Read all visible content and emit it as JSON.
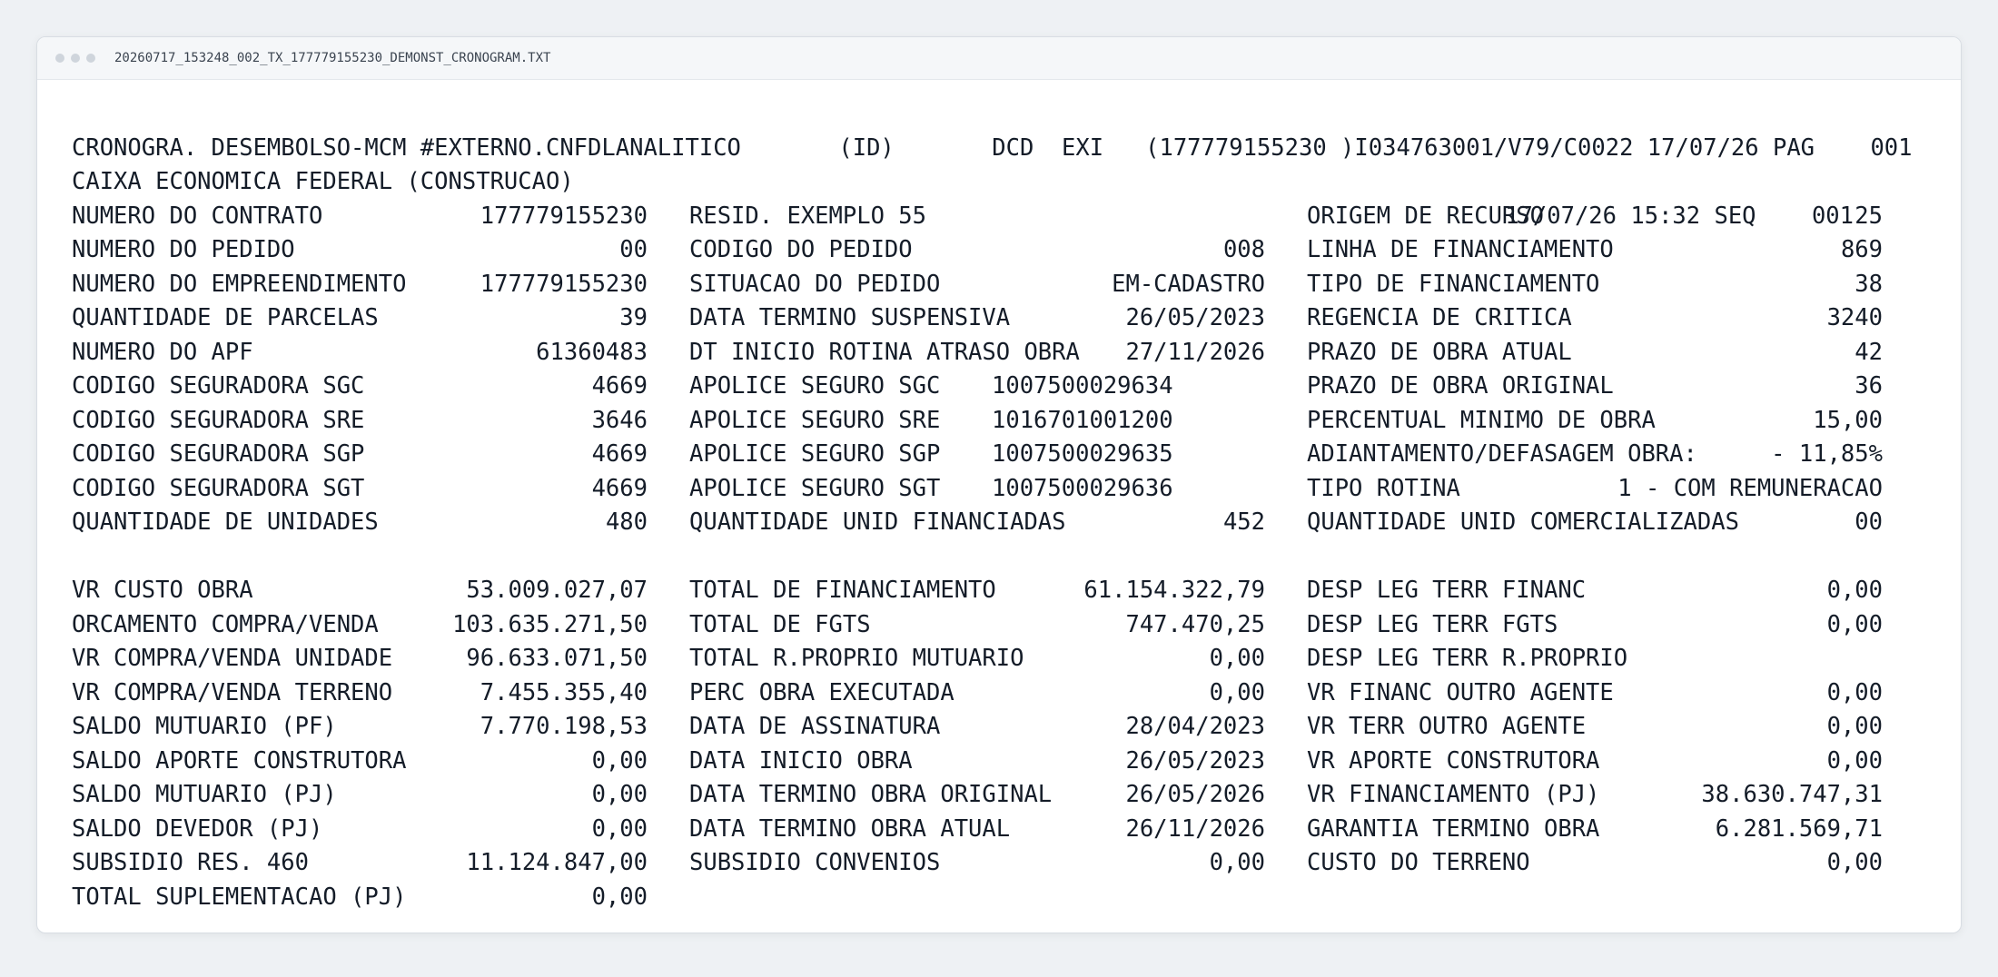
{
  "window": {
    "filename": "20260717_153248_002_TX_177779155230_DEMONST_CRONOGRAM.TXT"
  },
  "header": {
    "line1": "CRONOGRA. DESEMBOLSO-MCM #EXTERNO.CNFDLANALITICO       (ID)       DCD  EXI   (177779155230 )I034763001/V79/C0022 17/07/26 PAG    001",
    "line2_left": "CAIXA ECONOMICA FEDERAL (CONSTRUCAO)",
    "line2_right": "17/07/26 15:32 SEQ    001"
  },
  "section1": [
    [
      {
        "label": "NUMERO DO CONTRATO",
        "value": "177779155230"
      },
      {
        "label": "RESID. EXEMPLO 55",
        "value": ""
      },
      {
        "label": "ORIGEM DE RECURSO",
        "value": "25"
      }
    ],
    [
      {
        "label": "NUMERO DO PEDIDO",
        "value": "00"
      },
      {
        "label": "CODIGO DO PEDIDO",
        "value": "008"
      },
      {
        "label": "LINHA DE FINANCIAMENTO",
        "value": "869"
      }
    ],
    [
      {
        "label": "NUMERO DO EMPREENDIMENTO",
        "value": "177779155230"
      },
      {
        "label": "SITUACAO DO PEDIDO",
        "value": "EM-CADASTRO"
      },
      {
        "label": "TIPO DE FINANCIAMENTO",
        "value": "38"
      }
    ],
    [
      {
        "label": "QUANTIDADE DE PARCELAS",
        "value": "39"
      },
      {
        "label": "DATA TERMINO SUSPENSIVA",
        "value": "26/05/2023"
      },
      {
        "label": "REGENCIA DE CRITICA",
        "value": "3240"
      }
    ],
    [
      {
        "label": "NUMERO DO APF",
        "value": "61360483"
      },
      {
        "label": "DT INICIO ROTINA ATRASO OBRA",
        "value": "27/11/2026"
      },
      {
        "label": "PRAZO DE OBRA ATUAL",
        "value": "42"
      }
    ],
    [
      {
        "label": "CODIGO SEGURADORA SGC",
        "value": "4669"
      },
      {
        "label": "APOLICE SEGURO SGC",
        "value_mid": "1007500029634"
      },
      {
        "label": "PRAZO DE OBRA ORIGINAL",
        "value": "36"
      }
    ],
    [
      {
        "label": "CODIGO SEGURADORA SRE",
        "value": "3646"
      },
      {
        "label": "APOLICE SEGURO SRE",
        "value_mid": "1016701001200"
      },
      {
        "label": "PERCENTUAL MINIMO DE OBRA",
        "value": "15,00"
      }
    ],
    [
      {
        "label": "CODIGO SEGURADORA SGP",
        "value": "4669"
      },
      {
        "label": "APOLICE SEGURO SGP",
        "value_mid": "1007500029635"
      },
      {
        "label": "ADIANTAMENTO/DEFASAGEM OBRA:",
        "value": "- 11,85%"
      }
    ],
    [
      {
        "label": "CODIGO SEGURADORA SGT",
        "value": "4669"
      },
      {
        "label": "APOLICE SEGURO SGT",
        "value_mid": "1007500029636"
      },
      {
        "label": "TIPO ROTINA",
        "value": "1 - COM REMUNERACAO"
      }
    ],
    [
      {
        "label": "QUANTIDADE DE UNIDADES",
        "value": "480"
      },
      {
        "label": "QUANTIDADE UNID FINANCIADAS",
        "value": "452"
      },
      {
        "label": "QUANTIDADE UNID COMERCIALIZADAS",
        "value": "00"
      }
    ]
  ],
  "section2": [
    [
      {
        "label": "VR CUSTO OBRA",
        "value": "53.009.027,07"
      },
      {
        "label": "TOTAL DE FINANCIAMENTO",
        "value": "61.154.322,79"
      },
      {
        "label": "DESP LEG TERR FINANC",
        "value": "0,00"
      }
    ],
    [
      {
        "label": "ORCAMENTO COMPRA/VENDA",
        "value": "103.635.271,50"
      },
      {
        "label": "TOTAL DE FGTS",
        "value": "747.470,25"
      },
      {
        "label": "DESP LEG TERR FGTS",
        "value": "0,00"
      }
    ],
    [
      {
        "label": "VR COMPRA/VENDA UNIDADE",
        "value": "96.633.071,50"
      },
      {
        "label": "TOTAL R.PROPRIO MUTUARIO",
        "value": "0,00"
      },
      {
        "label": "DESP LEG TERR R.PROPRIO",
        "value": ""
      }
    ],
    [
      {
        "label": "VR COMPRA/VENDA TERRENO",
        "value": "7.455.355,40"
      },
      {
        "label": "PERC OBRA EXECUTADA",
        "value": "0,00"
      },
      {
        "label": "VR FINANC OUTRO AGENTE",
        "value": "0,00"
      }
    ],
    [
      {
        "label": "SALDO MUTUARIO (PF)",
        "value": "7.770.198,53"
      },
      {
        "label": "DATA DE ASSINATURA",
        "value": "28/04/2023"
      },
      {
        "label": "VR TERR OUTRO AGENTE",
        "value": "0,00"
      }
    ],
    [
      {
        "label": "SALDO APORTE CONSTRUTORA",
        "value": "0,00"
      },
      {
        "label": "DATA INICIO OBRA",
        "value": "26/05/2023"
      },
      {
        "label": "VR APORTE CONSTRUTORA",
        "value": "0,00"
      }
    ],
    [
      {
        "label": "SALDO MUTUARIO (PJ)",
        "value": "0,00"
      },
      {
        "label": "DATA TERMINO OBRA ORIGINAL",
        "value": "26/05/2026"
      },
      {
        "label": "VR FINANCIAMENTO (PJ)",
        "value": "38.630.747,31"
      }
    ],
    [
      {
        "label": "SALDO DEVEDOR (PJ)",
        "value": "0,00"
      },
      {
        "label": "DATA TERMINO OBRA ATUAL",
        "value": "26/11/2026"
      },
      {
        "label": "GARANTIA TERMINO OBRA",
        "value": "6.281.569,71"
      }
    ],
    [
      {
        "label": "SUBSIDIO RES. 460",
        "value": "11.124.847,00"
      },
      {
        "label": "SUBSIDIO CONVENIOS",
        "value": "0,00"
      },
      {
        "label": "CUSTO DO TERRENO",
        "value": "0,00"
      }
    ],
    [
      {
        "label": "TOTAL SUPLEMENTACAO (PJ)",
        "value": "0,00"
      }
    ]
  ]
}
